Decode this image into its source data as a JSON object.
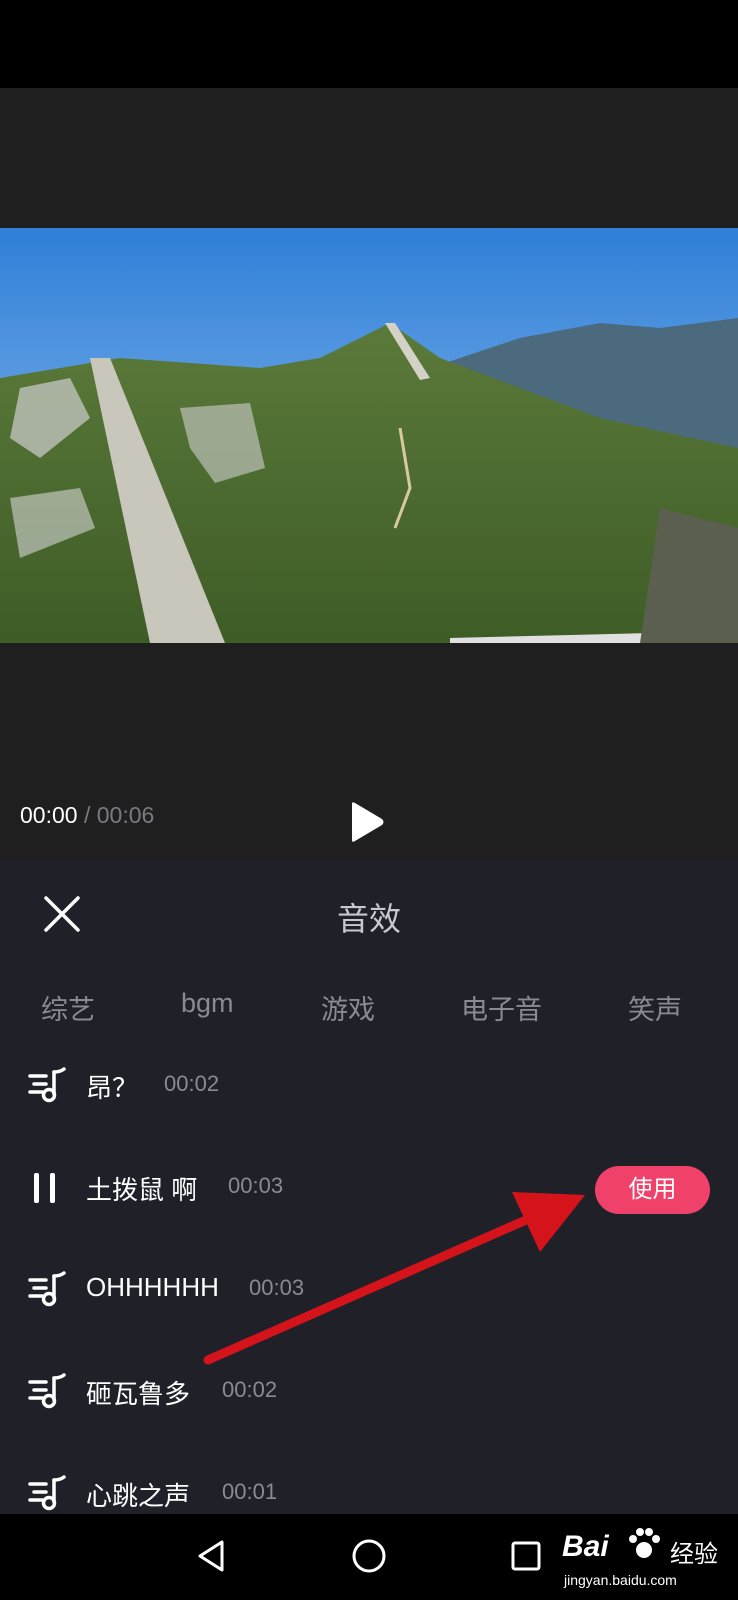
{
  "player": {
    "current_time": "00:00",
    "separator": " / ",
    "total_time": "00:06"
  },
  "panel": {
    "title": "音效",
    "tabs": [
      "综艺",
      "bgm",
      "游戏",
      "电子音",
      "笑声"
    ],
    "items": [
      {
        "name": "昂？",
        "duration": "00:02",
        "state": "idle"
      },
      {
        "name": "土拨鼠 啊",
        "duration": "00:03",
        "state": "playing"
      },
      {
        "name": "OHHHHHH",
        "duration": "00:03",
        "state": "idle"
      },
      {
        "name": "砸瓦鲁多",
        "duration": "00:02",
        "state": "idle"
      },
      {
        "name": "心跳之声",
        "duration": "00:01",
        "state": "idle"
      }
    ],
    "use_label": "使用"
  },
  "watermark": {
    "brand": "Bai",
    "brand_cn": "经验",
    "url": "jingyan.baidu.com"
  },
  "colors": {
    "accent": "#f0416b",
    "panel_bg": "#202029",
    "annotation_arrow": "#d4131b"
  },
  "icons": {
    "close": "close-icon",
    "play": "play-icon",
    "music": "music-note-icon",
    "pause": "pause-icon",
    "back": "back-triangle-icon",
    "home": "home-circle-icon",
    "recents": "recents-square-icon"
  }
}
